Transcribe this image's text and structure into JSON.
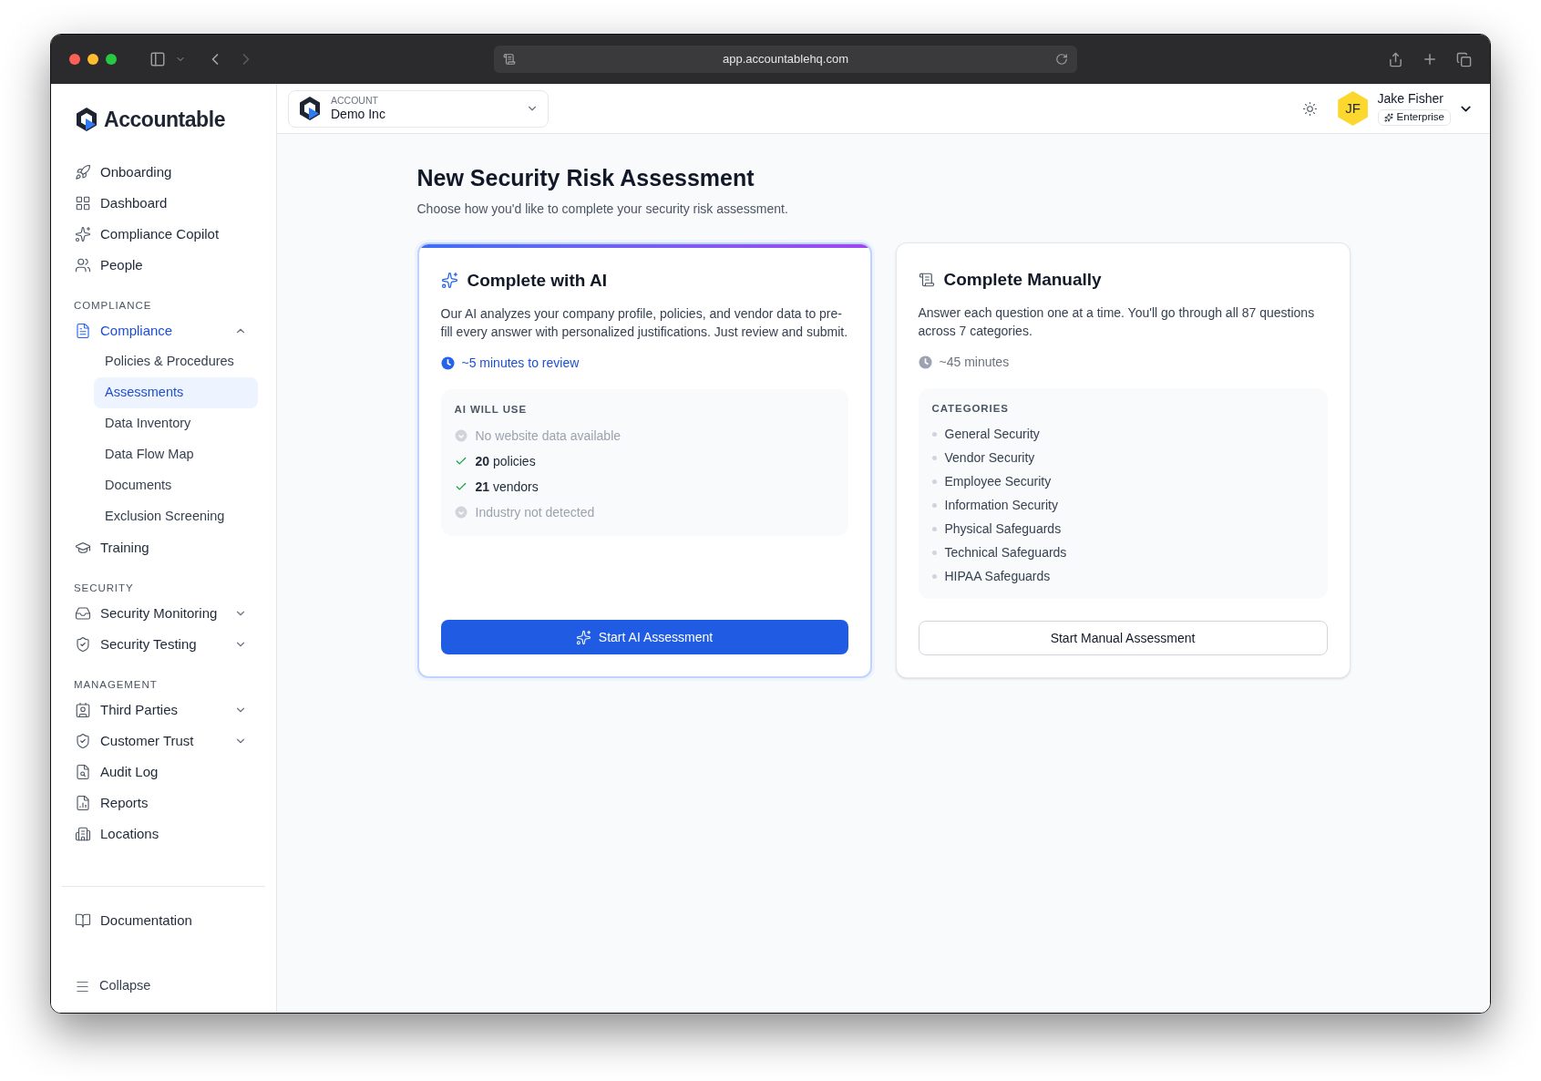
{
  "browser": {
    "url": "app.accountablehq.com"
  },
  "sidebar": {
    "logo": "Accountable",
    "sections": [
      {
        "items": [
          {
            "label": "Onboarding",
            "selected": false
          },
          {
            "label": "Dashboard",
            "selected": false
          },
          {
            "label": "Compliance Copilot",
            "selected": false
          },
          {
            "label": "People",
            "selected": false
          }
        ]
      },
      {
        "heading": "COMPLIANCE",
        "items": [
          {
            "label": "Compliance",
            "selected": true,
            "expanded": true,
            "children": [
              {
                "label": "Policies & Procedures",
                "selected": false
              },
              {
                "label": "Assessments",
                "selected": true
              },
              {
                "label": "Data Inventory",
                "selected": false
              },
              {
                "label": "Data Flow Map",
                "selected": false
              },
              {
                "label": "Documents",
                "selected": false
              },
              {
                "label": "Exclusion Screening",
                "selected": false
              }
            ]
          },
          {
            "label": "Training",
            "selected": false
          }
        ]
      },
      {
        "heading": "SECURITY",
        "items": [
          {
            "label": "Security Monitoring",
            "selected": false,
            "expanded": false
          },
          {
            "label": "Security Testing",
            "selected": false,
            "expanded": false
          }
        ]
      },
      {
        "heading": "MANAGEMENT",
        "items": [
          {
            "label": "Third Parties",
            "selected": false,
            "expanded": false
          },
          {
            "label": "Customer Trust",
            "selected": false,
            "expanded": false
          },
          {
            "label": "Audit Log",
            "selected": false
          },
          {
            "label": "Reports",
            "selected": false
          },
          {
            "label": "Locations",
            "selected": false
          }
        ]
      }
    ],
    "footer_items": [
      {
        "label": "Documentation",
        "selected": false
      }
    ],
    "collapse": "Collapse"
  },
  "header": {
    "account": {
      "label": "ACCOUNT",
      "name": "Demo Inc"
    },
    "user": {
      "initials": "JF",
      "name": "Jake Fisher",
      "plan": "Enterprise"
    }
  },
  "page": {
    "title": "New Security Risk Assessment",
    "subtitle": "Choose how you'd like to complete your security risk assessment."
  },
  "options": [
    {
      "kind": "ai",
      "selected": true,
      "title": "Complete with AI",
      "description": "Our AI analyzes your company profile, policies, and vendor data to pre-fill every answer with personalized justifications. Just review and submit.",
      "estimate": "~5 minutes to review",
      "panel": {
        "heading": "AI WILL USE",
        "items": [
          {
            "text": "No website data available",
            "available": false
          },
          {
            "text": "**20** policies",
            "available": true
          },
          {
            "text": "**21** vendors",
            "available": true
          },
          {
            "text": "Industry not detected",
            "available": false
          }
        ]
      },
      "button": "Start AI Assessment"
    },
    {
      "kind": "manual",
      "selected": false,
      "title": "Complete Manually",
      "description": "Answer each question one at a time. You'll go through all 87 questions across 7 categories.",
      "estimate": "~45 minutes",
      "panel": {
        "heading": "CATEGORIES",
        "items": [
          {
            "text": "General Security"
          },
          {
            "text": "Vendor Security"
          },
          {
            "text": "Employee Security"
          },
          {
            "text": "Information Security"
          },
          {
            "text": "Physical Safeguards"
          },
          {
            "text": "Technical Safeguards"
          },
          {
            "text": "HIPAA Safeguards"
          }
        ]
      },
      "button": "Start Manual Assessment"
    }
  ]
}
